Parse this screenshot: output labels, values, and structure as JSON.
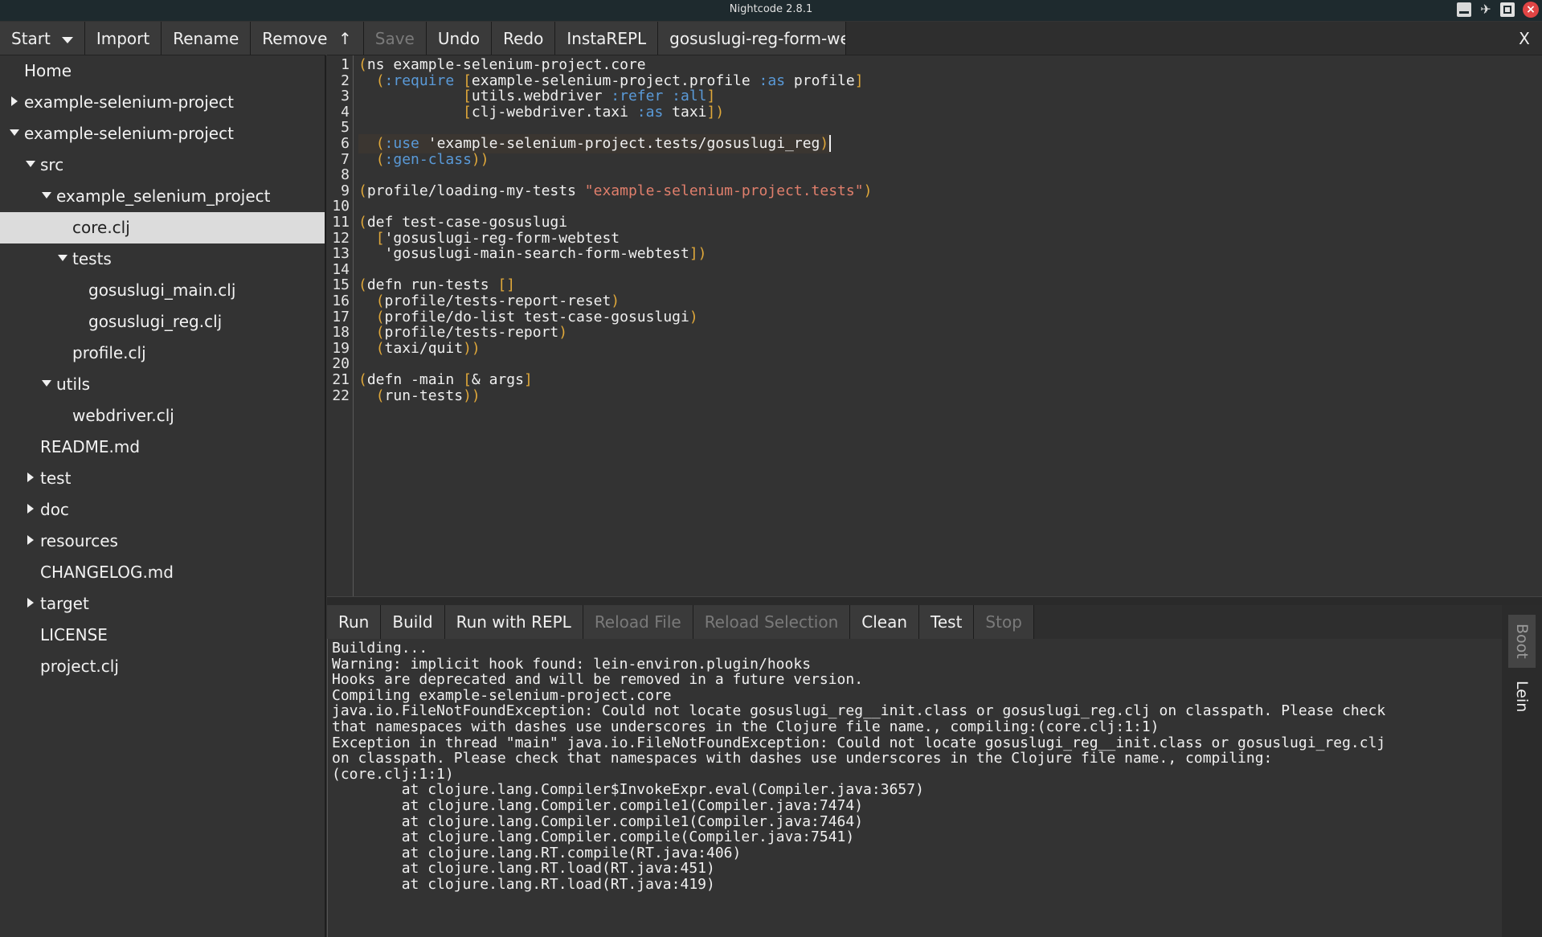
{
  "window": {
    "title": "Nightcode 2.8.1"
  },
  "project_toolbar": {
    "start": "Start",
    "import": "Import",
    "rename": "Rename",
    "remove": "Remove"
  },
  "tree": {
    "home": "Home",
    "project_collapsed": "example-selenium-project",
    "project_expanded": "example-selenium-project",
    "src": "src",
    "pkg": "example_selenium_project",
    "core": "core.clj",
    "tests": "tests",
    "gos_main": "gosuslugi_main.clj",
    "gos_reg": "gosuslugi_reg.clj",
    "profile": "profile.clj",
    "utils": "utils",
    "webdriver": "webdriver.clj",
    "readme": "README.md",
    "test": "test",
    "doc": "doc",
    "resources": "resources",
    "changelog": "CHANGELOG.md",
    "target": "target",
    "license": "LICENSE",
    "project": "project.clj"
  },
  "editor_toolbar": {
    "up": "↑",
    "save": "Save",
    "undo": "Undo",
    "redo": "Redo",
    "instarepl": "InstaREPL",
    "file_tab": "gosuslugi-reg-form-webt",
    "close": "X"
  },
  "colors": {
    "paren": "#e0a83a",
    "keyword": "#5a9ad8",
    "string": "#e07f6c",
    "text": "#f0f0f0"
  },
  "code": [
    {
      "n": "1",
      "segs": [
        [
          "(",
          "p"
        ],
        [
          "ns example-selenium-project.core",
          "t"
        ]
      ]
    },
    {
      "n": "2",
      "segs": [
        [
          "  ",
          "t"
        ],
        [
          "(",
          "p"
        ],
        [
          ":require",
          "k"
        ],
        [
          " ",
          "t"
        ],
        [
          "[",
          "p"
        ],
        [
          "example-selenium-project.profile ",
          "t"
        ],
        [
          ":as",
          "k"
        ],
        [
          " profile",
          "t"
        ],
        [
          "]",
          "p"
        ]
      ]
    },
    {
      "n": "3",
      "segs": [
        [
          "            ",
          "t"
        ],
        [
          "[",
          "p"
        ],
        [
          "utils.webdriver ",
          "t"
        ],
        [
          ":refer",
          "k"
        ],
        [
          " ",
          "t"
        ],
        [
          ":all",
          "k"
        ],
        [
          "]",
          "p"
        ]
      ]
    },
    {
      "n": "4",
      "segs": [
        [
          "            ",
          "t"
        ],
        [
          "[",
          "p"
        ],
        [
          "clj-webdriver.taxi ",
          "t"
        ],
        [
          ":as",
          "k"
        ],
        [
          " taxi",
          "t"
        ],
        [
          "])",
          "p"
        ]
      ]
    },
    {
      "n": "5",
      "segs": []
    },
    {
      "n": "6",
      "segs": [
        [
          "  ",
          "t"
        ],
        [
          "(",
          "p"
        ],
        [
          ":use",
          "k"
        ],
        [
          " 'example-selenium-project.tests/gosuslugi_reg",
          "t"
        ],
        [
          ")",
          "p"
        ]
      ],
      "highlight": true
    },
    {
      "n": "7",
      "segs": [
        [
          "  ",
          "t"
        ],
        [
          "(",
          "p"
        ],
        [
          ":gen-class",
          "k"
        ],
        [
          "))",
          "p"
        ]
      ]
    },
    {
      "n": "8",
      "segs": []
    },
    {
      "n": "9",
      "segs": [
        [
          "(",
          "p"
        ],
        [
          "profile/loading-my-tests ",
          "t"
        ],
        [
          "\"example-selenium-project.tests\"",
          "s"
        ],
        [
          ")",
          "p"
        ]
      ]
    },
    {
      "n": "10",
      "segs": []
    },
    {
      "n": "11",
      "segs": [
        [
          "(",
          "p"
        ],
        [
          "def test-case-gosuslugi",
          "t"
        ]
      ]
    },
    {
      "n": "12",
      "segs": [
        [
          "  ",
          "t"
        ],
        [
          "[",
          "p"
        ],
        [
          "'gosuslugi-reg-form-webtest",
          "t"
        ]
      ]
    },
    {
      "n": "13",
      "segs": [
        [
          "   'gosuslugi-main-search-form-webtest",
          "t"
        ],
        [
          "])",
          "p"
        ]
      ]
    },
    {
      "n": "14",
      "segs": []
    },
    {
      "n": "15",
      "segs": [
        [
          "(",
          "p"
        ],
        [
          "defn run-tests ",
          "t"
        ],
        [
          "[]",
          "p"
        ]
      ]
    },
    {
      "n": "16",
      "segs": [
        [
          "  ",
          "t"
        ],
        [
          "(",
          "p"
        ],
        [
          "profile/tests-report-reset",
          "t"
        ],
        [
          ")",
          "p"
        ]
      ]
    },
    {
      "n": "17",
      "segs": [
        [
          "  ",
          "t"
        ],
        [
          "(",
          "p"
        ],
        [
          "profile/do-list test-case-gosuslugi",
          "t"
        ],
        [
          ")",
          "p"
        ]
      ]
    },
    {
      "n": "18",
      "segs": [
        [
          "  ",
          "t"
        ],
        [
          "(",
          "p"
        ],
        [
          "profile/tests-report",
          "t"
        ],
        [
          ")",
          "p"
        ]
      ]
    },
    {
      "n": "19",
      "segs": [
        [
          "  ",
          "t"
        ],
        [
          "(",
          "p"
        ],
        [
          "taxi/quit",
          "t"
        ],
        [
          "))",
          "p"
        ]
      ]
    },
    {
      "n": "20",
      "segs": []
    },
    {
      "n": "21",
      "segs": [
        [
          "(",
          "p"
        ],
        [
          "defn -main ",
          "t"
        ],
        [
          "[",
          "p"
        ],
        [
          "& args",
          "t"
        ],
        [
          "]",
          "p"
        ]
      ]
    },
    {
      "n": "22",
      "segs": [
        [
          "  ",
          "t"
        ],
        [
          "(",
          "p"
        ],
        [
          "run-tests",
          "t"
        ],
        [
          "))",
          "p"
        ]
      ]
    }
  ],
  "build_toolbar": {
    "run": "Run",
    "build": "Build",
    "run_repl": "Run with REPL",
    "reload_file": "Reload File",
    "reload_selection": "Reload Selection",
    "clean": "Clean",
    "test": "Test",
    "stop": "Stop"
  },
  "console": [
    "Building...",
    "Warning: implicit hook found: lein-environ.plugin/hooks",
    "Hooks are deprecated and will be removed in a future version.",
    "Compiling example-selenium-project.core",
    "java.io.FileNotFoundException: Could not locate gosuslugi_reg__init.class or gosuslugi_reg.clj on classpath. Please check",
    "that namespaces with dashes use underscores in the Clojure file name., compiling:(core.clj:1:1)",
    "Exception in thread \"main\" java.io.FileNotFoundException: Could not locate gosuslugi_reg__init.class or gosuslugi_reg.clj",
    "on classpath. Please check that namespaces with dashes use underscores in the Clojure file name., compiling:",
    "(core.clj:1:1)",
    "        at clojure.lang.Compiler$InvokeExpr.eval(Compiler.java:3657)",
    "        at clojure.lang.Compiler.compile1(Compiler.java:7474)",
    "        at clojure.lang.Compiler.compile1(Compiler.java:7464)",
    "        at clojure.lang.Compiler.compile(Compiler.java:7541)",
    "        at clojure.lang.RT.compile(RT.java:406)",
    "        at clojure.lang.RT.load(RT.java:451)",
    "        at clojure.lang.RT.load(RT.java:419)"
  ],
  "build_tabs": {
    "boot": "Boot",
    "lein": "Lein"
  }
}
